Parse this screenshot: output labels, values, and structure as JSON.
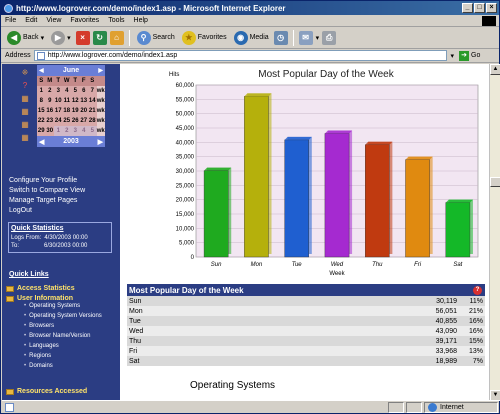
{
  "window": {
    "title": "http://www.logrover.com/demo/index1.asp - Microsoft Internet Explorer",
    "min": "_",
    "max": "□",
    "close": "×"
  },
  "menu": [
    "File",
    "Edit",
    "View",
    "Favorites",
    "Tools",
    "Help"
  ],
  "toolbar": {
    "back": "Back",
    "search": "Search",
    "favorites": "Favorites",
    "media": "Media"
  },
  "address": {
    "label": "Address",
    "url": "http://www.logrover.com/demo/index1.asp",
    "go": "Go"
  },
  "calendar": {
    "month": "June",
    "year": "2003",
    "day_headers": [
      "S",
      "M",
      "T",
      "W",
      "T",
      "F",
      "S",
      ""
    ],
    "rows": [
      [
        "1",
        "2",
        "3",
        "4",
        "5",
        "6",
        "7",
        "wk"
      ],
      [
        "8",
        "9",
        "10",
        "11",
        "12",
        "13",
        "14",
        "wk"
      ],
      [
        "15",
        "16",
        "17",
        "18",
        "19",
        "20",
        "21",
        "wk"
      ],
      [
        "22",
        "23",
        "24",
        "25",
        "26",
        "27",
        "28",
        "wk"
      ],
      [
        "29",
        "30",
        "1",
        "2",
        "3",
        "4",
        "5",
        "wk"
      ]
    ]
  },
  "sidebar": {
    "links": [
      "Configure Your Profile",
      "Switch to Compare View",
      "Manage Target Pages",
      "LogOut"
    ],
    "quick_stats": {
      "title": "Quick Statistics",
      "from_label": "Logs From:",
      "from_value": "4/30/2003 00:00",
      "to_label": "To:",
      "to_value": "6/30/2003 00:00"
    },
    "quick_links_title": "Quick Links",
    "access_statistics": "Access Statistics",
    "user_information": "User Information",
    "sub_items": [
      "Operating Systems",
      "Operating System Versions",
      "Browsers",
      "Browser Name/Version",
      "Languages",
      "Regions",
      "Domains"
    ],
    "resources_accessed": "Resources Accessed"
  },
  "chart_data": {
    "type": "bar",
    "title": "Most Popular Day of the Week",
    "ylabel": "Hits",
    "xlabel": "Week",
    "categories": [
      "Sun",
      "Mon",
      "Tue",
      "Wed",
      "Thu",
      "Fri",
      "Sat"
    ],
    "values": [
      30119,
      56051,
      40855,
      43090,
      39171,
      33968,
      18989
    ],
    "colors": [
      "#1faa1f",
      "#b5b00c",
      "#1f5fd0",
      "#a52ad0",
      "#c03a10",
      "#e08a10",
      "#14b828"
    ],
    "ylim": [
      0,
      60000
    ],
    "yticks": [
      "0",
      "5,000",
      "10,000",
      "15,000",
      "20,000",
      "25,000",
      "30,000",
      "35,000",
      "40,000",
      "45,000",
      "50,000",
      "55,000",
      "60,000"
    ],
    "grid": true,
    "plot_bg": "#f2e6f2"
  },
  "table": {
    "title": "Most Popular Day of the Week",
    "rows": [
      {
        "day": "Sun",
        "hits": "30,119",
        "pct": "11%"
      },
      {
        "day": "Mon",
        "hits": "56,051",
        "pct": "21%"
      },
      {
        "day": "Tue",
        "hits": "40,855",
        "pct": "16%"
      },
      {
        "day": "Wed",
        "hits": "43,090",
        "pct": "16%"
      },
      {
        "day": "Thu",
        "hits": "39,171",
        "pct": "15%"
      },
      {
        "day": "Fri",
        "hits": "33,968",
        "pct": "13%"
      },
      {
        "day": "Sat",
        "hits": "18,989",
        "pct": "7%"
      }
    ]
  },
  "next_section": "Operating Systems",
  "status": {
    "zone": "Internet"
  }
}
